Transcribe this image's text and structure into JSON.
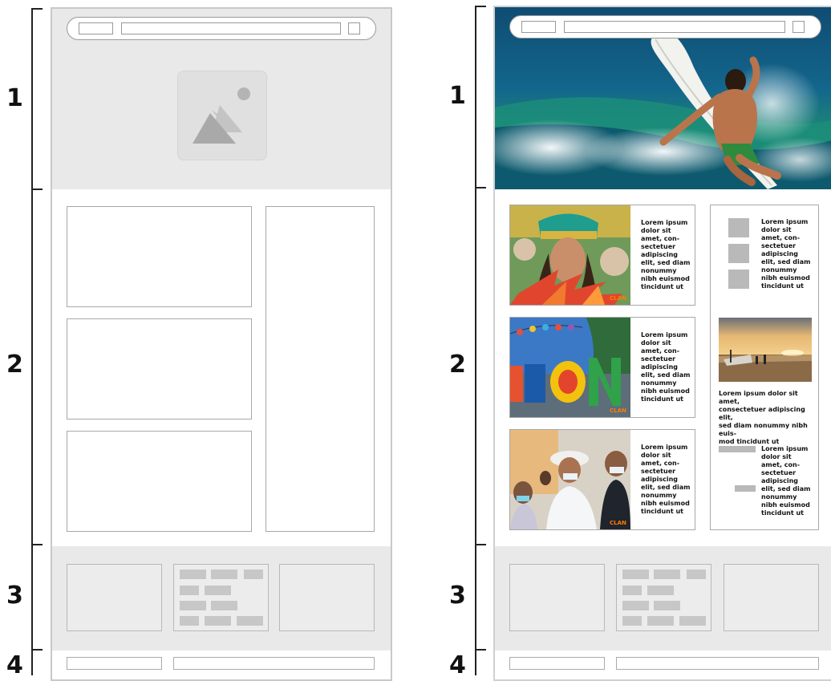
{
  "sections": [
    {
      "number": "1"
    },
    {
      "number": "2"
    },
    {
      "number": "3"
    },
    {
      "number": "4"
    }
  ],
  "wireframe": {
    "image_placeholder_icon": "image-icon"
  },
  "mockup": {
    "card_text": "Lorem ipsum\ndolor sit\namet, con-\nsectetuer\nadipiscing\nelit, sed diam\nnonummy\nnibh euismod\ntincidunt ut",
    "sidebar_caption": "Lorem ipsum dolor sit amet,\nconsectetuer adipiscing elit,\nsed diam nonummy nibh euis-\nmod tincidunt ut",
    "badge": "CLAN"
  },
  "colors": {
    "placeholder_gray": "#e9e9e9",
    "bracket": "#222222"
  }
}
